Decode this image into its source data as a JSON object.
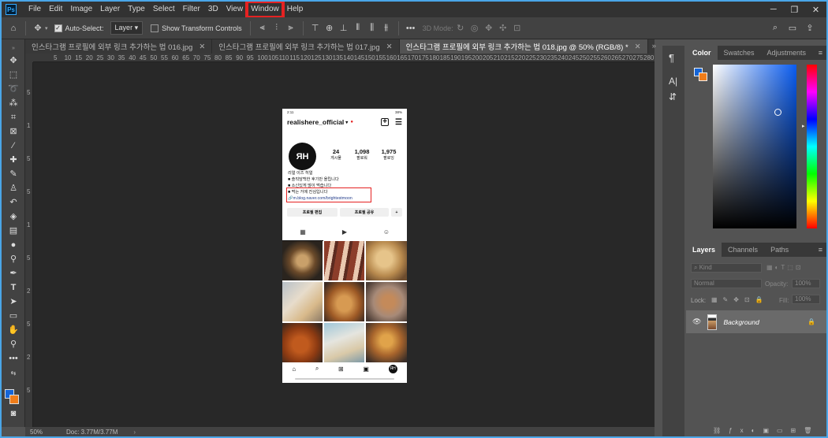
{
  "menubar": {
    "logo": "Ps",
    "items": [
      "File",
      "Edit",
      "Image",
      "Layer",
      "Type",
      "Select",
      "Filter",
      "3D",
      "View",
      "Window",
      "Help"
    ],
    "highlighted": "Window"
  },
  "options": {
    "auto_select_label": "Auto-Select:",
    "auto_select_target": "Layer",
    "transform_label": "Show Transform Controls",
    "mode_3d": "3D Mode:"
  },
  "tabs": [
    {
      "label": "인스타그램 프로필에 외부 링크 추가하는 법 016.jpg",
      "active": false
    },
    {
      "label": "인스타그램 프로필에 외부 링크 추가하는 법 017.jpg",
      "active": false
    },
    {
      "label": "인스타그램 프로필에 외부 링크 추가하는 법 018.jpg @ 50% (RGB/8) *",
      "active": true
    }
  ],
  "rulers": {
    "h": [
      "5",
      "10",
      "15",
      "20",
      "25",
      "30",
      "35",
      "40",
      "45",
      "50",
      "55",
      "60",
      "65",
      "70",
      "75",
      "80",
      "85",
      "90",
      "95",
      "100",
      "105",
      "110",
      "115",
      "120",
      "125",
      "130",
      "135",
      "140",
      "145",
      "150",
      "155",
      "160",
      "165",
      "170",
      "175",
      "180",
      "185",
      "190",
      "195",
      "200",
      "205",
      "210",
      "215",
      "220",
      "225",
      "230",
      "235",
      "240",
      "245",
      "250",
      "255",
      "260",
      "265",
      "270",
      "275",
      "280"
    ],
    "v": [
      "5",
      "1",
      "5",
      "5",
      "1",
      "5",
      "2",
      "5",
      "2",
      "5"
    ]
  },
  "status": {
    "zoom": "50%",
    "doc": "Doc: 3.77M/3.77M"
  },
  "color_panel": {
    "tabs": [
      "Color",
      "Swatches",
      "Adjustments"
    ],
    "fg": "#1565d8",
    "bg": "#f07d1a"
  },
  "layers_panel": {
    "tabs": [
      "Layers",
      "Channels",
      "Paths"
    ],
    "kind_placeholder": "Kind",
    "blend_mode": "Normal",
    "opacity_label": "Opacity:",
    "opacity": "100%",
    "lock_label": "Lock:",
    "fill_label": "Fill:",
    "fill": "100%",
    "layers": [
      {
        "name": "Background"
      }
    ]
  },
  "phone": {
    "time": "2:11",
    "battery": "38%",
    "username": "realishere_official",
    "avatar_text": "ЯH",
    "stats": [
      {
        "num": "24",
        "label": "게시물"
      },
      {
        "num": "1,098",
        "label": "팔로워"
      },
      {
        "num": "1,975",
        "label": "팔로잉"
      }
    ],
    "bio": [
      "리얼 이즈 히얼",
      "■ 솔직담백한 후기만 올립니다",
      "■ 소신있게 많이 먹습니다",
      "■ 먹는 거에 진심입니다"
    ],
    "link": "m.blog.naver.com/brightestmoon",
    "buttons": [
      "프로필 편집",
      "프로필 공유"
    ]
  }
}
